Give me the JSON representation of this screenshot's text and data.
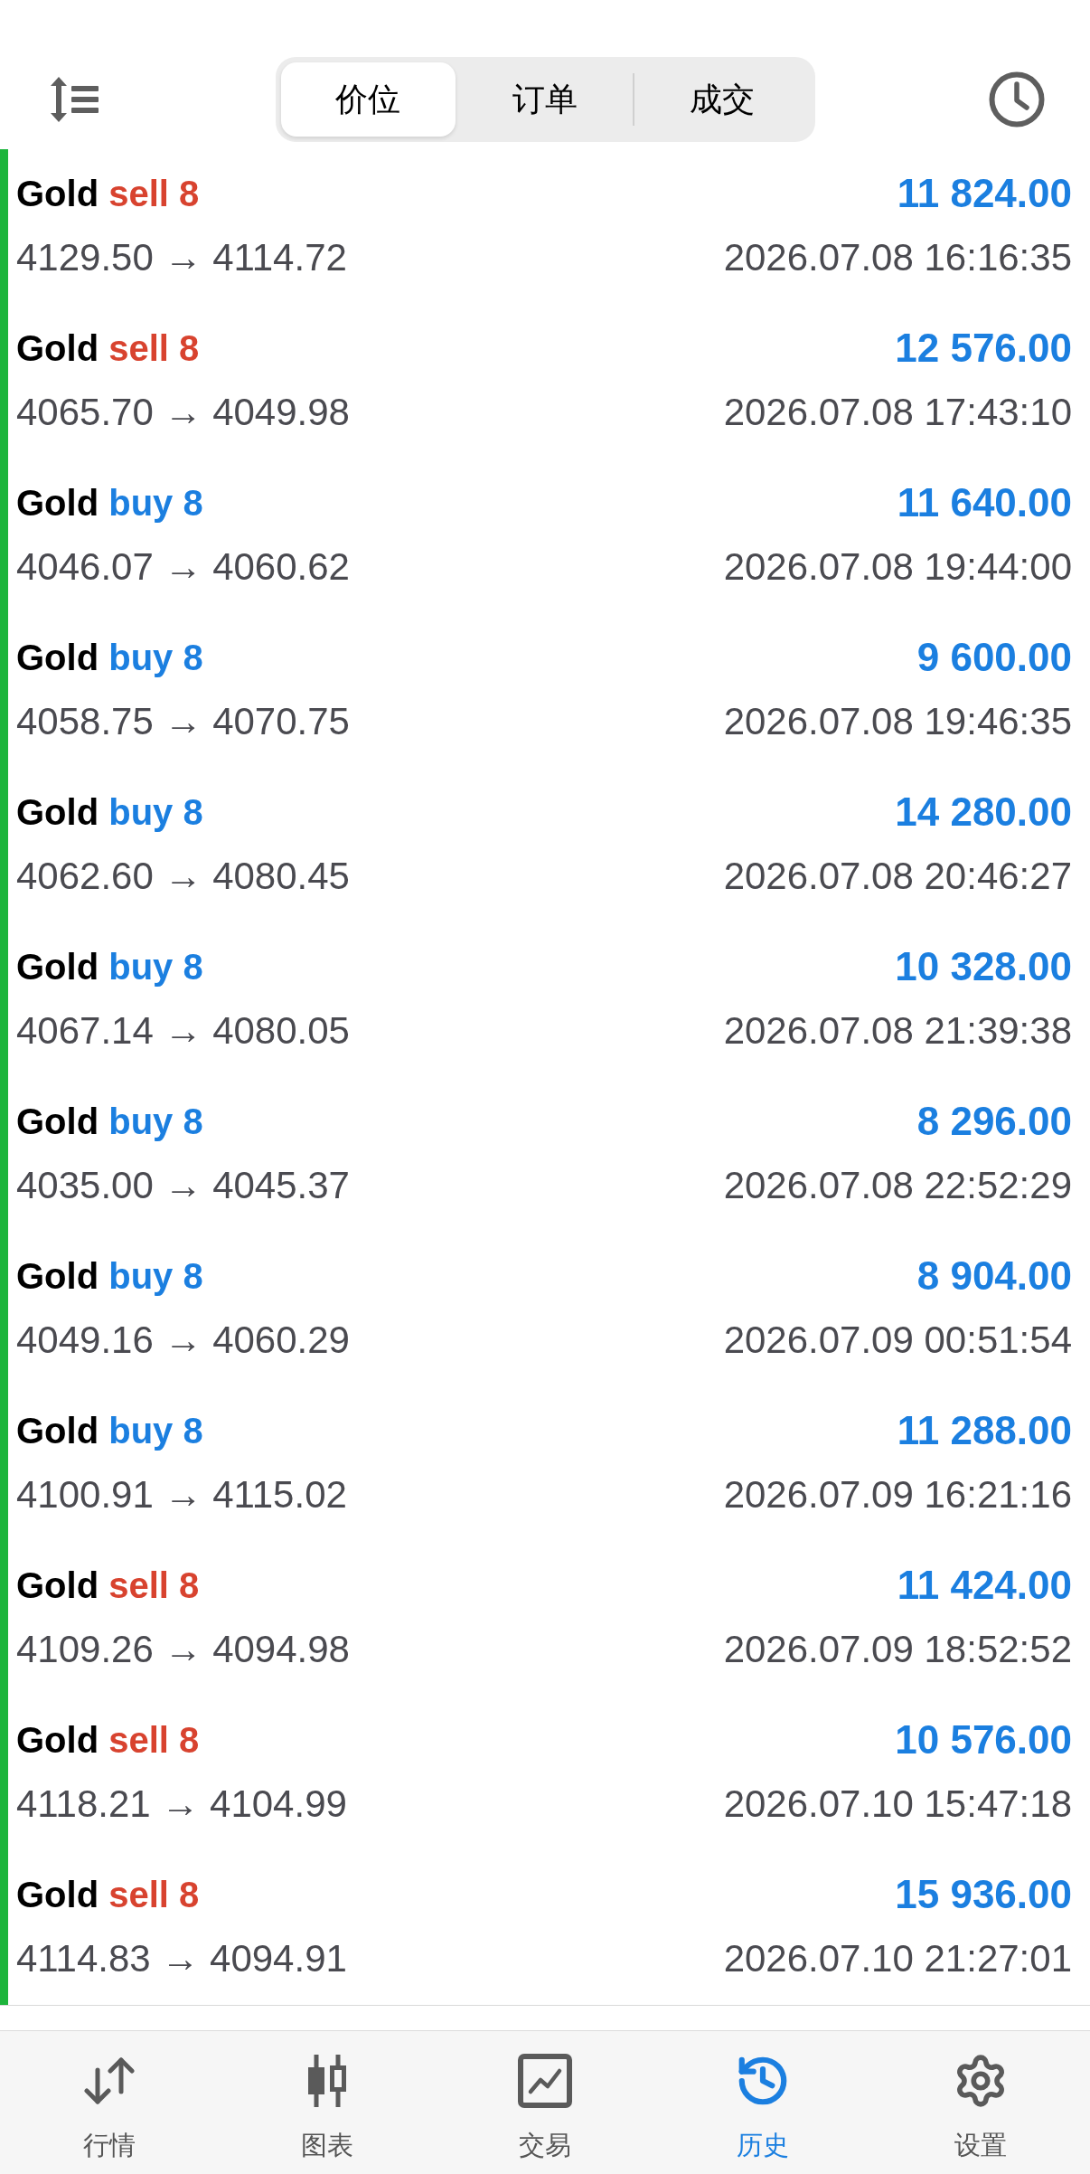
{
  "toolbar": {
    "segments": [
      {
        "label": "价位",
        "selected": true
      },
      {
        "label": "订单",
        "selected": false
      },
      {
        "label": "成交",
        "selected": false
      }
    ]
  },
  "deals": [
    {
      "symbol": "Gold",
      "order": "sell 8",
      "kind": "sell",
      "prices": "4129.50 → 4114.72",
      "profit": "11 824.00",
      "time": "2026.07.08 16:16:35"
    },
    {
      "symbol": "Gold",
      "order": "sell 8",
      "kind": "sell",
      "prices": "4065.70 → 4049.98",
      "profit": "12 576.00",
      "time": "2026.07.08 17:43:10"
    },
    {
      "symbol": "Gold",
      "order": "buy 8",
      "kind": "buy",
      "prices": "4046.07 → 4060.62",
      "profit": "11 640.00",
      "time": "2026.07.08 19:44:00"
    },
    {
      "symbol": "Gold",
      "order": "buy 8",
      "kind": "buy",
      "prices": "4058.75 → 4070.75",
      "profit": "9 600.00",
      "time": "2026.07.08 19:46:35"
    },
    {
      "symbol": "Gold",
      "order": "buy 8",
      "kind": "buy",
      "prices": "4062.60 → 4080.45",
      "profit": "14 280.00",
      "time": "2026.07.08 20:46:27"
    },
    {
      "symbol": "Gold",
      "order": "buy 8",
      "kind": "buy",
      "prices": "4067.14 → 4080.05",
      "profit": "10 328.00",
      "time": "2026.07.08 21:39:38"
    },
    {
      "symbol": "Gold",
      "order": "buy 8",
      "kind": "buy",
      "prices": "4035.00 → 4045.37",
      "profit": "8 296.00",
      "time": "2026.07.08 22:52:29"
    },
    {
      "symbol": "Gold",
      "order": "buy 8",
      "kind": "buy",
      "prices": "4049.16 → 4060.29",
      "profit": "8 904.00",
      "time": "2026.07.09 00:51:54"
    },
    {
      "symbol": "Gold",
      "order": "buy 8",
      "kind": "buy",
      "prices": "4100.91 → 4115.02",
      "profit": "11 288.00",
      "time": "2026.07.09 16:21:16"
    },
    {
      "symbol": "Gold",
      "order": "sell 8",
      "kind": "sell",
      "prices": "4109.26 → 4094.98",
      "profit": "11 424.00",
      "time": "2026.07.09 18:52:52"
    },
    {
      "symbol": "Gold",
      "order": "sell 8",
      "kind": "sell",
      "prices": "4118.21 → 4104.99",
      "profit": "10 576.00",
      "time": "2026.07.10 15:47:18"
    },
    {
      "symbol": "Gold",
      "order": "sell 8",
      "kind": "sell",
      "prices": "4114.83 → 4094.91",
      "profit": "15 936.00",
      "time": "2026.07.10 21:27:01"
    }
  ],
  "bottom_nav": [
    {
      "label": "行情",
      "kind": "quotes",
      "selected": false
    },
    {
      "label": "图表",
      "kind": "chart",
      "selected": false
    },
    {
      "label": "交易",
      "kind": "trade",
      "selected": false
    },
    {
      "label": "历史",
      "kind": "history",
      "selected": true
    },
    {
      "label": "设置",
      "kind": "settings",
      "selected": false
    }
  ]
}
